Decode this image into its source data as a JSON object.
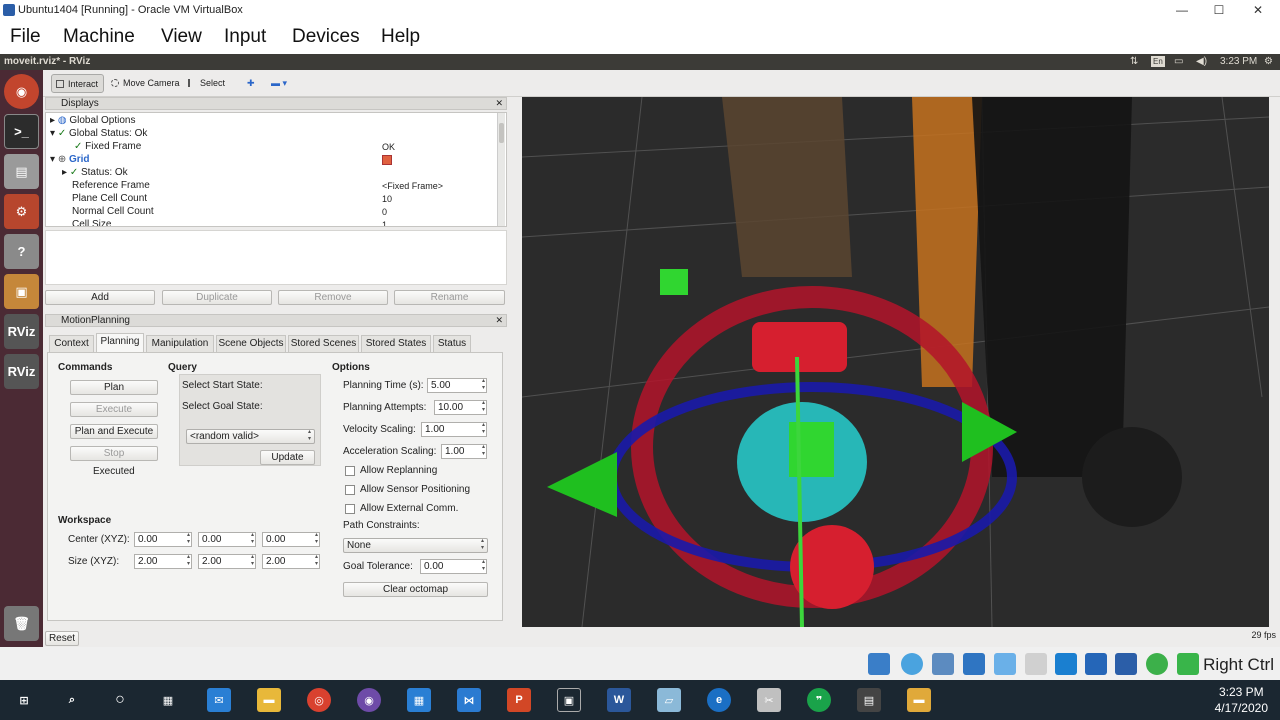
{
  "window": {
    "title": "Ubuntu1404 [Running] - Oracle VM VirtualBox",
    "minimize": "—",
    "maximize": "☐",
    "close": "✕"
  },
  "vb_menu": [
    "File",
    "Machine",
    "View",
    "Input",
    "Devices",
    "Help"
  ],
  "ubuntu_panel": {
    "app_title": "moveit.rviz* - RViz",
    "lang": "En",
    "time": "3:23 PM"
  },
  "launcher": [
    "ubuntu-dash-icon",
    "terminal-icon",
    "file-cabinet-icon",
    "system-settings-icon",
    "help-icon",
    "virtualbox-icon",
    "rviz-icon",
    "rviz-icon",
    "trash-icon"
  ],
  "launcher_labels": {
    "rviz1": "RViz",
    "rviz2": "RViz"
  },
  "toolbar": {
    "interact": "Interact",
    "move_camera": "Move Camera",
    "select": "Select",
    "add": "✚",
    "minus": "▬ ▾"
  },
  "displays_panel": {
    "title": "Displays",
    "rows": [
      {
        "label": "Global Options",
        "value": ""
      },
      {
        "label": "Global Status: Ok",
        "value": ""
      },
      {
        "label": "Fixed Frame",
        "value": "OK"
      },
      {
        "label": "Grid",
        "value": ""
      },
      {
        "label": "Status: Ok",
        "value": ""
      },
      {
        "label": "Reference Frame",
        "value": "<Fixed Frame>"
      },
      {
        "label": "Plane Cell Count",
        "value": "10"
      },
      {
        "label": "Normal Cell Count",
        "value": "0"
      },
      {
        "label": "Cell Size",
        "value": "1"
      }
    ],
    "buttons": {
      "add": "Add",
      "duplicate": "Duplicate",
      "remove": "Remove",
      "rename": "Rename"
    }
  },
  "motion_planning": {
    "title": "MotionPlanning",
    "tabs": [
      "Context",
      "Planning",
      "Manipulation",
      "Scene Objects",
      "Stored Scenes",
      "Stored States",
      "Status"
    ],
    "commands": {
      "heading": "Commands",
      "plan": "Plan",
      "execute": "Execute",
      "plan_execute": "Plan and Execute",
      "stop": "Stop",
      "status": "Executed"
    },
    "query": {
      "heading": "Query",
      "start": "Select Start State:",
      "goal": "Select Goal State:",
      "goal_value": "<random valid>",
      "update": "Update"
    },
    "options": {
      "heading": "Options",
      "planning_time_label": "Planning Time (s):",
      "planning_time": "5.00",
      "planning_attempts_label": "Planning Attempts:",
      "planning_attempts": "10.00",
      "velocity_label": "Velocity Scaling:",
      "velocity": "1.00",
      "accel_label": "Acceleration Scaling:",
      "accel": "1.00",
      "replanning": "Allow Replanning",
      "sensor": "Allow Sensor Positioning",
      "external": "Allow External Comm.",
      "path_constraints_label": "Path Constraints:",
      "path_constraints": "None",
      "goal_tol_label": "Goal Tolerance:",
      "goal_tol": "0.00",
      "clear_octomap": "Clear octomap"
    },
    "workspace": {
      "heading": "Workspace",
      "center_label": "Center (XYZ):",
      "center": [
        "0.00",
        "0.00",
        "0.00"
      ],
      "size_label": "Size (XYZ):",
      "size": [
        "2.00",
        "2.00",
        "2.00"
      ]
    }
  },
  "status_bar": {
    "reset": "Reset",
    "fps": "29 fps"
  },
  "vb_status": {
    "host_key": "Right Ctrl"
  },
  "taskbar": {
    "time": "3:23 PM",
    "date": "4/17/2020"
  },
  "colors": {
    "launcher": "#4b2a34",
    "ubuntu_panel": "#3c3b37",
    "taskbar": "#1b2731",
    "viewport": "#2b2b2b"
  }
}
